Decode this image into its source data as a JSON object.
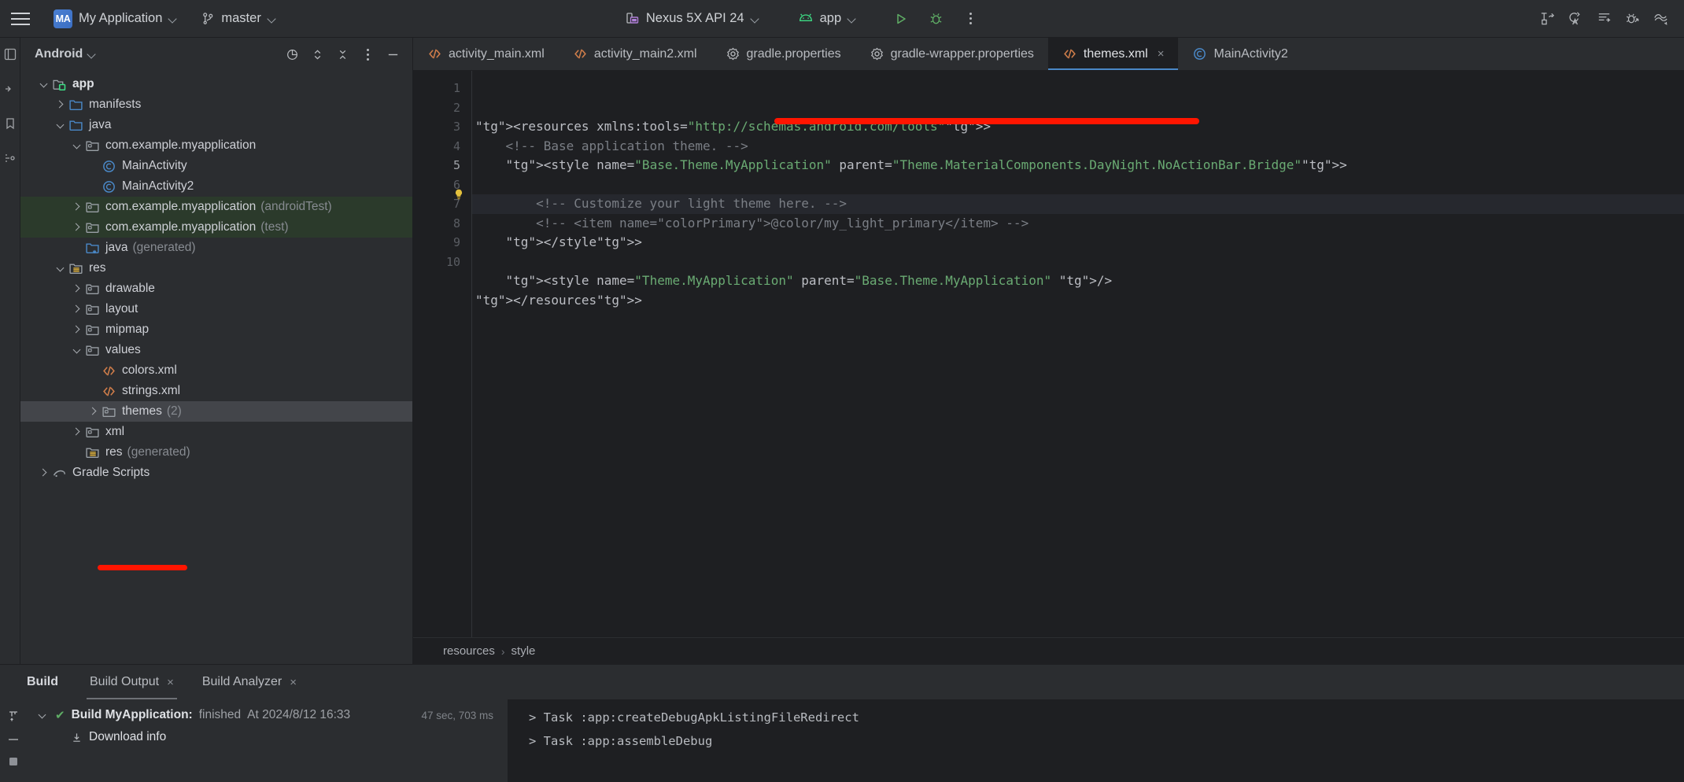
{
  "toolbar": {
    "menu_icon": "hamburger-icon",
    "project_badge": "MA",
    "project_name": "My Application",
    "branch_icon": "git-branch-icon",
    "branch_name": "master",
    "device_icon": "device-icon",
    "device_name": "Nexus 5X API 24",
    "run_config_icon": "android-icon",
    "run_config_name": "app",
    "run_icon": "run-triangle-icon",
    "debug_icon": "debug-bug-icon",
    "more_icon": "more-vertical-icon",
    "right_icons": [
      "layout-inspector-icon",
      "code-with-me-icon",
      "logcat-icon",
      "profiler-icon",
      "app-quality-insights-icon"
    ]
  },
  "rail": {
    "icons": [
      "project-view-icon",
      "resource-manager-icon",
      "bookmarks-icon",
      "structure-icon"
    ]
  },
  "project_panel": {
    "title": "Android",
    "title_chevron": "chevron-down-icon",
    "header_icons": [
      "select-opened-file-icon",
      "expand-collapse-icon",
      "collapse-all-icon",
      "options-icon",
      "hide-icon"
    ],
    "tree": [
      {
        "label": "app",
        "suffix": "",
        "indent": 0,
        "arrow": "down",
        "icon": "module-folder-icon",
        "bold": true,
        "state": "normal"
      },
      {
        "label": "manifests",
        "suffix": "",
        "indent": 1,
        "arrow": "right",
        "icon": "folder-blue-icon",
        "bold": false,
        "state": "normal"
      },
      {
        "label": "java",
        "suffix": "",
        "indent": 1,
        "arrow": "down",
        "icon": "folder-blue-icon",
        "bold": false,
        "state": "normal"
      },
      {
        "label": "com.example.myapplication",
        "suffix": "",
        "indent": 2,
        "arrow": "down",
        "icon": "package-folder-icon",
        "bold": false,
        "state": "normal"
      },
      {
        "label": "MainActivity",
        "suffix": "",
        "indent": 3,
        "arrow": "none",
        "icon": "java-class-icon",
        "bold": false,
        "state": "normal"
      },
      {
        "label": "MainActivity2",
        "suffix": "",
        "indent": 3,
        "arrow": "none",
        "icon": "java-class-icon",
        "bold": false,
        "state": "normal"
      },
      {
        "label": "com.example.myapplication",
        "suffix": "(androidTest)",
        "indent": 2,
        "arrow": "right",
        "icon": "package-folder-icon",
        "bold": false,
        "state": "test"
      },
      {
        "label": "com.example.myapplication",
        "suffix": "(test)",
        "indent": 2,
        "arrow": "right",
        "icon": "package-folder-icon",
        "bold": false,
        "state": "test"
      },
      {
        "label": "java",
        "suffix": "(generated)",
        "indent": 2,
        "arrow": "none",
        "icon": "folder-generated-icon",
        "bold": false,
        "state": "normal"
      },
      {
        "label": "res",
        "suffix": "",
        "indent": 1,
        "arrow": "down",
        "icon": "res-folder-icon",
        "bold": false,
        "state": "normal"
      },
      {
        "label": "drawable",
        "suffix": "",
        "indent": 2,
        "arrow": "right",
        "icon": "package-folder-icon",
        "bold": false,
        "state": "normal"
      },
      {
        "label": "layout",
        "suffix": "",
        "indent": 2,
        "arrow": "right",
        "icon": "package-folder-icon",
        "bold": false,
        "state": "normal"
      },
      {
        "label": "mipmap",
        "suffix": "",
        "indent": 2,
        "arrow": "right",
        "icon": "package-folder-icon",
        "bold": false,
        "state": "normal"
      },
      {
        "label": "values",
        "suffix": "",
        "indent": 2,
        "arrow": "down",
        "icon": "package-folder-icon",
        "bold": false,
        "state": "normal"
      },
      {
        "label": "colors.xml",
        "suffix": "",
        "indent": 3,
        "arrow": "none",
        "icon": "xml-file-icon",
        "bold": false,
        "state": "normal"
      },
      {
        "label": "strings.xml",
        "suffix": "",
        "indent": 3,
        "arrow": "none",
        "icon": "xml-file-icon",
        "bold": false,
        "state": "normal"
      },
      {
        "label": "themes",
        "suffix": "(2)",
        "indent": 3,
        "arrow": "right",
        "icon": "package-folder-icon",
        "bold": false,
        "state": "selected"
      },
      {
        "label": "xml",
        "suffix": "",
        "indent": 2,
        "arrow": "right",
        "icon": "package-folder-icon",
        "bold": false,
        "state": "normal"
      },
      {
        "label": "res",
        "suffix": "(generated)",
        "indent": 2,
        "arrow": "none",
        "icon": "res-generated-icon",
        "bold": false,
        "state": "normal"
      },
      {
        "label": "Gradle Scripts",
        "suffix": "",
        "indent": 0,
        "arrow": "right",
        "icon": "gradle-icon",
        "bold": false,
        "state": "normal"
      }
    ]
  },
  "editor": {
    "tabs": [
      {
        "label": "activity_main.xml",
        "icon": "xml-file-icon",
        "active": false,
        "closable": false
      },
      {
        "label": "activity_main2.xml",
        "icon": "xml-file-icon",
        "active": false,
        "closable": false
      },
      {
        "label": "gradle.properties",
        "icon": "properties-icon",
        "active": false,
        "closable": false
      },
      {
        "label": "gradle-wrapper.properties",
        "icon": "properties-icon",
        "active": false,
        "closable": false
      },
      {
        "label": "themes.xml",
        "icon": "xml-file-icon",
        "active": true,
        "closable": true
      },
      {
        "label": "MainActivity2",
        "icon": "java-class-icon",
        "active": false,
        "closable": false
      }
    ],
    "tab_close_glyph": "×",
    "line_numbers": [
      "1",
      "2",
      "3",
      "4",
      "5",
      "6",
      "7",
      "8",
      "9",
      "10"
    ],
    "current_line": 5,
    "inspection_icon": "lightbulb-icon",
    "code_lines": [
      "<resources xmlns:tools=\"http://schemas.android.com/tools\">",
      "    <!-- Base application theme. -->",
      "    <style name=\"Base.Theme.MyApplication\" parent=\"Theme.MaterialComponents.DayNight.NoActionBar.Bridge\">",
      "",
      "        <!-- Customize your light theme here. -->",
      "        <!-- <item name=\"colorPrimary\">@color/my_light_primary</item> -->",
      "    </style>",
      "",
      "    <style name=\"Theme.MyApplication\" parent=\"Base.Theme.MyApplication\" />",
      "</resources>"
    ],
    "breadcrumbs": [
      "resources",
      "style"
    ],
    "breadcrumb_separator": "›",
    "annotation_color": "#ff1500"
  },
  "build_panel": {
    "title": "Build",
    "tabs": [
      {
        "label": "Build Output",
        "closable": true,
        "active": true
      },
      {
        "label": "Build Analyzer",
        "closable": true,
        "active": false
      }
    ],
    "close_glyph": "×",
    "rail_icons": [
      "filter-icon",
      "soft-wrap-icon",
      "settings-icon"
    ],
    "tree": [
      {
        "arrow": "down",
        "status_icon": "check-green-icon",
        "title": "Build MyApplication:",
        "status": "finished",
        "timestamp": "At 2024/8/12 16:33",
        "duration": "47 sec, 703 ms"
      },
      {
        "arrow": "none",
        "icon": "download-icon",
        "title": "Download info",
        "status": "",
        "timestamp": "",
        "duration": ""
      }
    ],
    "tasks": [
      "> Task :app:createDebugApkListingFileRedirect",
      "> Task :app:assembleDebug"
    ]
  }
}
